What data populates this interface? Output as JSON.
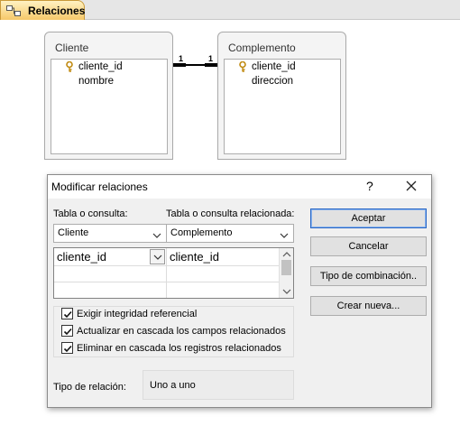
{
  "tab": {
    "label": "Relaciones"
  },
  "tables": {
    "left": {
      "title": "Cliente",
      "fields": [
        "cliente_id",
        "nombre"
      ]
    },
    "right": {
      "title": "Complemento",
      "fields": [
        "cliente_id",
        "direccion"
      ]
    }
  },
  "relationship": {
    "left_card": "1",
    "right_card": "1"
  },
  "dialog": {
    "title": "Modificar relaciones",
    "help": "?",
    "close": "✕",
    "table_label": "Tabla o consulta:",
    "related_label": "Tabla o consulta relacionada:",
    "table_value": "Cliente",
    "related_value": "Complemento",
    "grid": {
      "left_field": "cliente_id",
      "right_field": "cliente_id"
    },
    "buttons": {
      "accept": "Aceptar",
      "cancel": "Cancelar",
      "join_type": "Tipo de combinación..",
      "new": "Crear nueva..."
    },
    "options": {
      "enforce": "Exigir integridad referencial",
      "cascade_update": "Actualizar en cascada los campos relacionados",
      "cascade_delete": "Eliminar en cascada los registros relacionados"
    },
    "reltype_label": "Tipo de relación:",
    "reltype_value": "Uno a uno"
  }
}
